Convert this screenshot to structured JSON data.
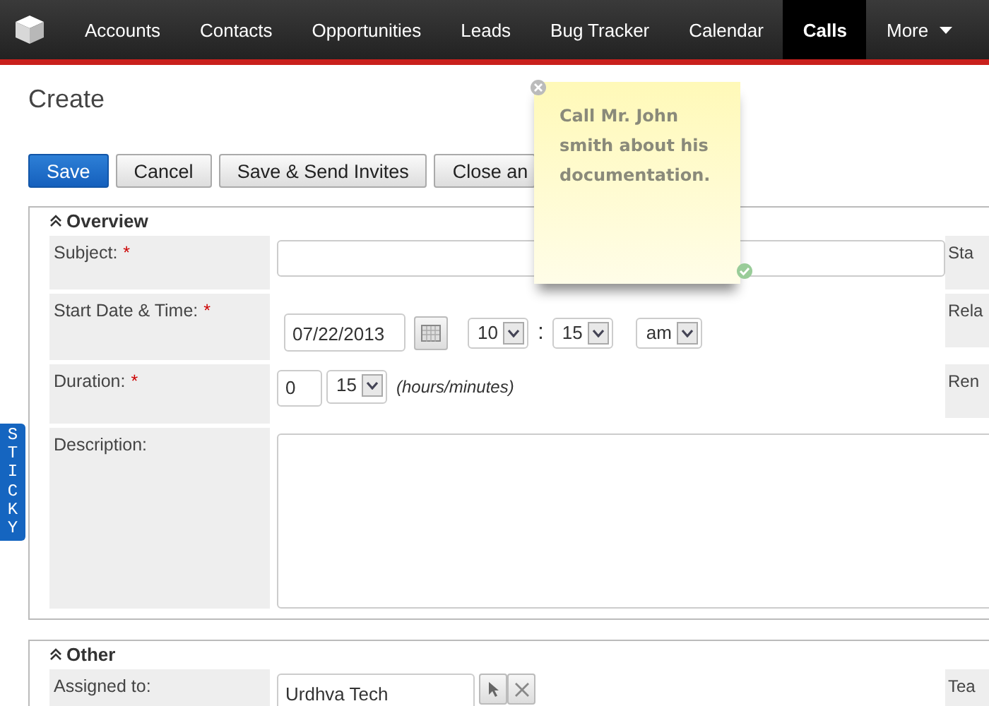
{
  "nav": {
    "items": [
      {
        "label": "Accounts",
        "selected": false
      },
      {
        "label": "Contacts",
        "selected": false
      },
      {
        "label": "Opportunities",
        "selected": false
      },
      {
        "label": "Leads",
        "selected": false
      },
      {
        "label": "Bug Tracker",
        "selected": false
      },
      {
        "label": "Calendar",
        "selected": false
      },
      {
        "label": "Calls",
        "selected": true
      },
      {
        "label": "More",
        "selected": false,
        "kind": "menu"
      }
    ]
  },
  "page_title": "Create",
  "buttons": [
    {
      "label": "Save",
      "kind": "primary"
    },
    {
      "label": "Cancel",
      "kind": "default"
    },
    {
      "label": "Save & Send Invites",
      "kind": "default"
    },
    {
      "label": "Close an",
      "kind": "default"
    }
  ],
  "panels": [
    {
      "title": "Overview",
      "rows": [
        {
          "kind": "text",
          "label": "Subject:",
          "required_mark": "*",
          "side_label": "Sta"
        },
        {
          "kind": "datetime",
          "label": "Start Date & Time:",
          "required_mark": "*",
          "date": "07/22/2013",
          "hour": "10",
          "separator": ":",
          "minute": "15",
          "meridiem": "am",
          "side_label": "Rela"
        },
        {
          "kind": "duration",
          "label": "Duration:",
          "required_mark": "*",
          "hours": "0",
          "minutes": "15",
          "hint": "(hours/minutes)",
          "side_label": "Ren"
        },
        {
          "kind": "textarea",
          "label": "Description:"
        }
      ]
    },
    {
      "title": "Other",
      "rows": [
        {
          "kind": "relate",
          "label": "Assigned to:",
          "value": "Urdhva Tech",
          "side_label": "Tea"
        }
      ]
    }
  ],
  "sticky_note": {
    "text": "Call Mr. John smith about his documentation."
  },
  "sticky_tab": {
    "label": "STICKY"
  }
}
